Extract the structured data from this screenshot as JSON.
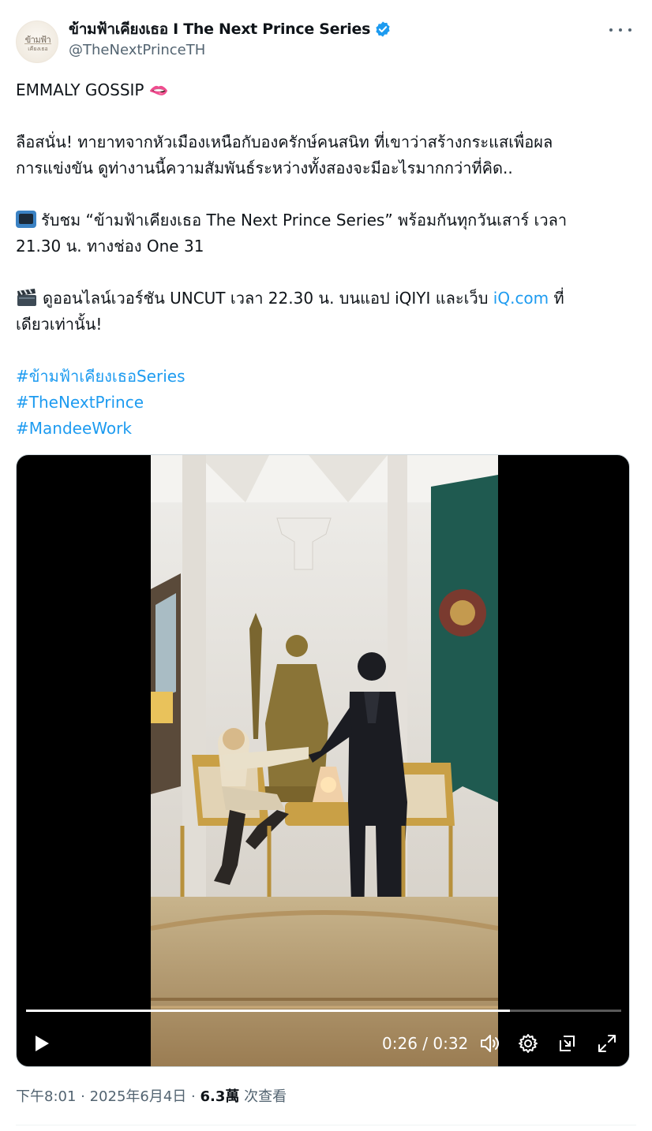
{
  "author": {
    "display_name": "ข้ามฟ้าเคียงเธอ I The Next Prince Series",
    "handle": "@TheNextPrinceTH",
    "avatar_text_line1": "ข้ามฟ้า",
    "avatar_text_line2": "เคียงเธอ",
    "verified": true,
    "verified_color": "#1d9bf0"
  },
  "post": {
    "line1": "EMMALY GOSSIP 🫦",
    "line2": "ลือสนั่น! ทายาทจากหัวเมืองเหนือกับองครักษ์คนสนิท ที่เขาว่าสร้างกระแสเพื่อผล",
    "line3": "การแข่งขัน ดูท่างานนี้ความสัมพันธ์ระหว่างทั้งสองจะมีอะไรมากกว่าที่คิด..",
    "line4": "รับชม “ข้ามฟ้าเคียงเธอ The Next Prince Series” พร้อมกันทุกวันเสาร์ เวลา",
    "line5": "21.30 น. ทางช่อง One 31",
    "line6_pre": "ดูออนไลน์เวอร์ชัน UNCUT เวลา 22.30 น. บนแอป iQIYI และเว็บ ",
    "line6_link": "iQ.com",
    "line6_post": " ที่",
    "line7": "เดียวเท่านั้น!",
    "hashtags": [
      "#ข้ามฟ้าเคียงเธอSeries",
      "#TheNextPrince",
      "#MandeeWork"
    ],
    "tv_emoji": "television-icon",
    "clapper_emoji": "clapper-board-icon"
  },
  "video": {
    "current_time": "0:26",
    "duration": "0:32",
    "time_display": "0:26 / 0:32",
    "progress": 0.8125
  },
  "meta": {
    "time": "下午8:01 · 2025年6月4日 · ",
    "views_count": "6.3萬",
    "views_label": " 次查看"
  }
}
